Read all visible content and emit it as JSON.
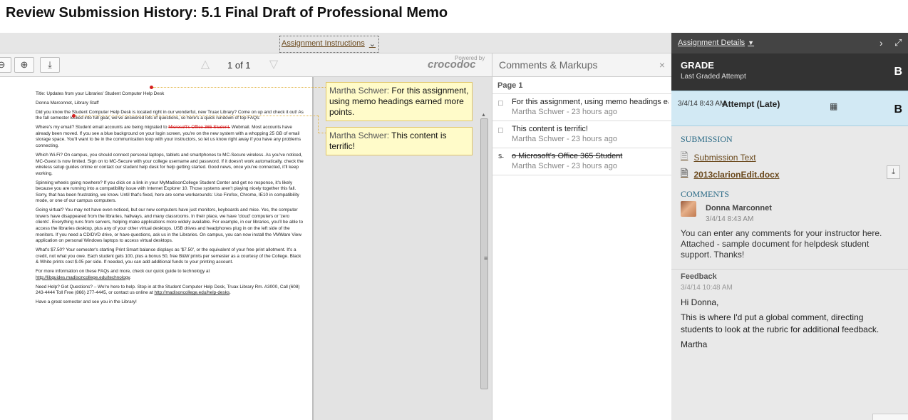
{
  "page": {
    "title": "Review Submission History: 5.1 Final Draft of Professional Memo"
  },
  "instructions_button": {
    "label": "Assignment Instructions"
  },
  "viewer": {
    "page_counter": "1 of 1",
    "branding": "crocodoc",
    "branding_prefix": "Powered by"
  },
  "document": {
    "paragraphs": [
      "Title: Updates from your Libraries' Student Computer Help Desk",
      "Donna Marconnet, Library Staff",
      "Did you know the Student Computer Help Desk is located right in our wonderful, new Truax Library? Come on up and check it out! As the fall semester kicked into full gear, we've answered lots of questions, so here's a quick rundown of top FAQs:",
      "Which Wi-Fi? On campus, you should connect personal laptops, tablets and smartphones to MC-Secure wireless. As you've noticed, MC-Guest is now limited. Sign on to MC-Secure with your college username and password. If it doesn't work automatically, check the wireless setup guides online or contact our student help desk for help getting started. Good news, once you've connected, it'll keep working.",
      "Spinning wheels going nowhere? If you click on a link in your MyMadisonCollege Student Center and get no response, it's likely because you are running into a compatibility issue with Internet Explorer 10. Those systems aren't playing nicely together this fall. Sorry, that has been frustrating, we know. Until that's fixed, here are some workarounds: Use Firefox, Chrome, IE10 in compatibility mode, or one of our campus computers.",
      "Going virtual? You may not have even noticed, but our new computers have just monitors, keyboards and mice. Yes, the computer towers have disappeared from the libraries, hallways, and many classrooms. In their place, we have 'cloud' computers or 'zero clients'. Everything runs from servers, helping make applications more widely available. For example, in our libraries, you'll be able to access the libraries desktop, plus any of your other virtual desktops. USB drives and headphones plug in on the left side of the monitors. If you need a CD/DVD drive, or have questions, ask us in the Libraries. On campus, you can now install the VMWare View application on personal Windows laptops to access virtual desktops.",
      "What's $7.50? Your semester's starting Print Smart balance displays as '$7.50', or the equivalent of your free print allotment. It's a credit, not what you owe. Each student gets 100, plus a bonus 50, free B&W prints per semester as a courtesy of the College. Black & White prints cost $.05 per side. If needed, you can add additional funds to your printing account.",
      "Have a great semester and see you in the Library!"
    ],
    "email": {
      "before": "Where's my email? Student email accounts are being migrated to ",
      "struck": "Microsoft's Office 365 Student.",
      "after": " Webmail. Most accounts have already been moved. If you see a blue background on your login screen, you're on the new system with a whopping 25 GB of email storage space. You'll want to be in the communication loop with your instructors, so let us know right away if you have any problems connecting."
    },
    "faq_para": {
      "before": "For more information on these FAQs and more, check our quick guide to technology at ",
      "link": "http://libguides.madisoncollege.edu/technology",
      "after": "."
    },
    "help_para": {
      "before": "Need Help? Got Questions? – We're here to help. Stop in at the Student Computer Help Desk, Truax Library Rm. A3000, Call (608) 243-4444 Toll Free (866) 277-4445, or contact us online at ",
      "link": "http://madisoncollege.edu/help-desks",
      "after": "."
    }
  },
  "annotations": [
    {
      "author": "Martha Schwer:",
      "text": " For this assignment, using memo headings earned more points."
    },
    {
      "author": "Martha Schwer:",
      "text": " This content is terrific!"
    }
  ],
  "comments_panel": {
    "title": "Comments & Markups",
    "page_label": "Page 1",
    "items": [
      {
        "text": "For this assignment, using memo headings earned more points.",
        "meta": "Martha Schwer - 23 hours ago"
      },
      {
        "text": "This content is terrific!",
        "meta": "Martha Schwer - 23 hours ago"
      },
      {
        "text": "o Microsoft's Office 365 Student",
        "meta": "Martha Schwer - 23 hours ago"
      }
    ]
  },
  "sidebar": {
    "details_link": "Assignment Details",
    "grade_label": "GRADE",
    "grade_sub": "Last Graded Attempt",
    "grade_value": "B",
    "attempt": {
      "date": "3/4/14 8:43 AM",
      "title": "Attempt (Late)",
      "grade": "B"
    },
    "submission_heading": "SUBMISSION",
    "files": [
      "Submission Text",
      "2013clarionEdit.docx"
    ],
    "comments_heading": "COMMENTS",
    "comment": {
      "author": "Donna Marconnet",
      "date": "3/4/14 8:43 AM",
      "text": "You can enter any comments for your instructor here. Attached - sample document for helpdesk student support.  Thanks!"
    },
    "feedback": {
      "heading": "Feedback",
      "date": "3/4/14 10:48 AM",
      "lines": [
        "Hi Donna,",
        "This is where I'd put a global comment, directing students to look at the rubric for additional feedback.",
        "Martha"
      ]
    }
  },
  "colors": {
    "link_brown": "#6b4a1e",
    "heading_teal": "#2a6a86",
    "note_yellow": "#fffbc9",
    "pin_red": "#d42020"
  },
  "icons": [
    "zoom-out-icon",
    "zoom-in-icon",
    "download-icon",
    "triangle-up-icon",
    "triangle-down-icon",
    "close-icon",
    "comment-icon",
    "strikethrough-icon",
    "chevron-right-icon",
    "expand-icon",
    "grid-icon",
    "file-icon"
  ]
}
